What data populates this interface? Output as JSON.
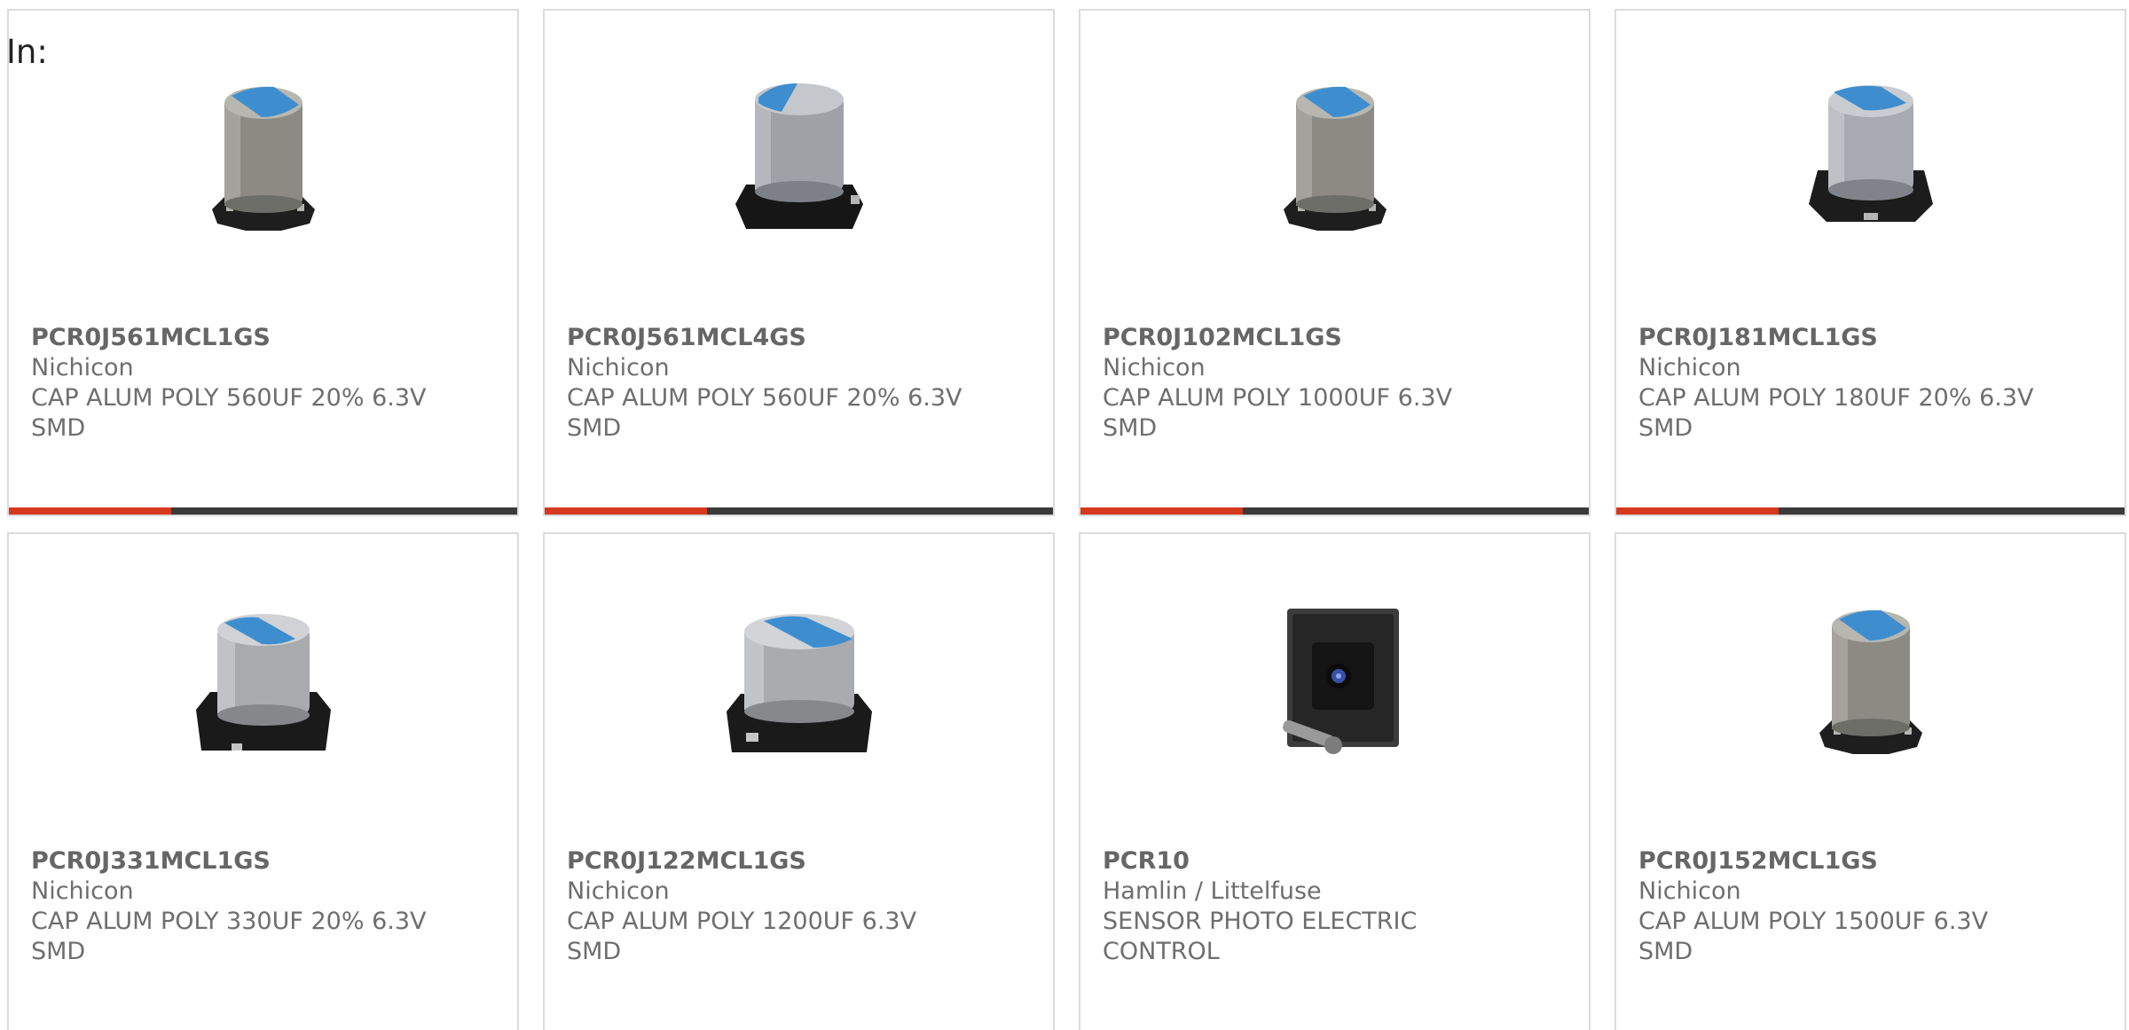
{
  "header": {
    "in_label": "In:"
  },
  "accent_color": "#d6381d",
  "bar_color": "#3a3a3a",
  "products": [
    {
      "part": "PCR0J561MCL1GS",
      "mfr": "Nichicon",
      "desc1": "CAP ALUM POLY 560UF 20% 6.3V",
      "desc2": "SMD",
      "icon": "smd-capacitor-tall-icon"
    },
    {
      "part": "PCR0J561MCL4GS",
      "mfr": "Nichicon",
      "desc1": "CAP ALUM POLY 560UF 20% 6.3V",
      "desc2": "SMD",
      "icon": "smd-capacitor-icon"
    },
    {
      "part": "PCR0J102MCL1GS",
      "mfr": "Nichicon",
      "desc1": "CAP ALUM POLY 1000UF 6.3V",
      "desc2": "SMD",
      "icon": "smd-capacitor-tall-icon"
    },
    {
      "part": "PCR0J181MCL1GS",
      "mfr": "Nichicon",
      "desc1": "CAP ALUM POLY 180UF 20% 6.3V",
      "desc2": "SMD",
      "icon": "smd-capacitor-icon"
    },
    {
      "part": "PCR0J331MCL1GS",
      "mfr": "Nichicon",
      "desc1": "CAP ALUM POLY 330UF 20% 6.3V",
      "desc2": "SMD",
      "icon": "smd-capacitor-icon"
    },
    {
      "part": "PCR0J122MCL1GS",
      "mfr": "Nichicon",
      "desc1": "CAP ALUM POLY 1200UF 6.3V",
      "desc2": "SMD",
      "icon": "smd-capacitor-wide-icon"
    },
    {
      "part": "PCR10",
      "mfr": "Hamlin / Littelfuse",
      "desc1": "SENSOR PHOTO ELECTRIC",
      "desc2": "CONTROL",
      "icon": "photo-sensor-icon"
    },
    {
      "part": "PCR0J152MCL1GS",
      "mfr": "Nichicon",
      "desc1": "CAP ALUM POLY 1500UF 6.3V",
      "desc2": "SMD",
      "icon": "smd-capacitor-tall-icon"
    }
  ]
}
